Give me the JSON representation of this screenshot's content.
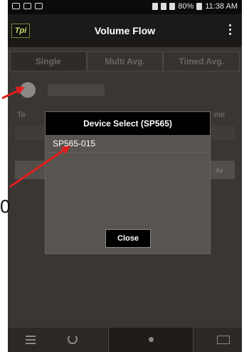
{
  "status_bar": {
    "right_text": "80%",
    "time": "11:38 AM"
  },
  "app_bar": {
    "logo_text": "Tpi",
    "title": "Volume Flow"
  },
  "tabs": [
    {
      "label": "Single",
      "active": true
    },
    {
      "label": "Multi Avg.",
      "active": false
    },
    {
      "label": "Timed Avg.",
      "active": false
    }
  ],
  "background": {
    "left_label": "Te",
    "right_label": "me",
    "row_label": "Air"
  },
  "dialog": {
    "title": "Device Select (SP565)",
    "items": [
      "SP565-015"
    ],
    "close_label": "Close"
  },
  "annotation": {
    "side_number": "0",
    "arrow_color": "#e01e1e"
  },
  "colors": {
    "background": "#3a3633",
    "app_bar": "#1c1a18",
    "dialog": "#58544f"
  }
}
